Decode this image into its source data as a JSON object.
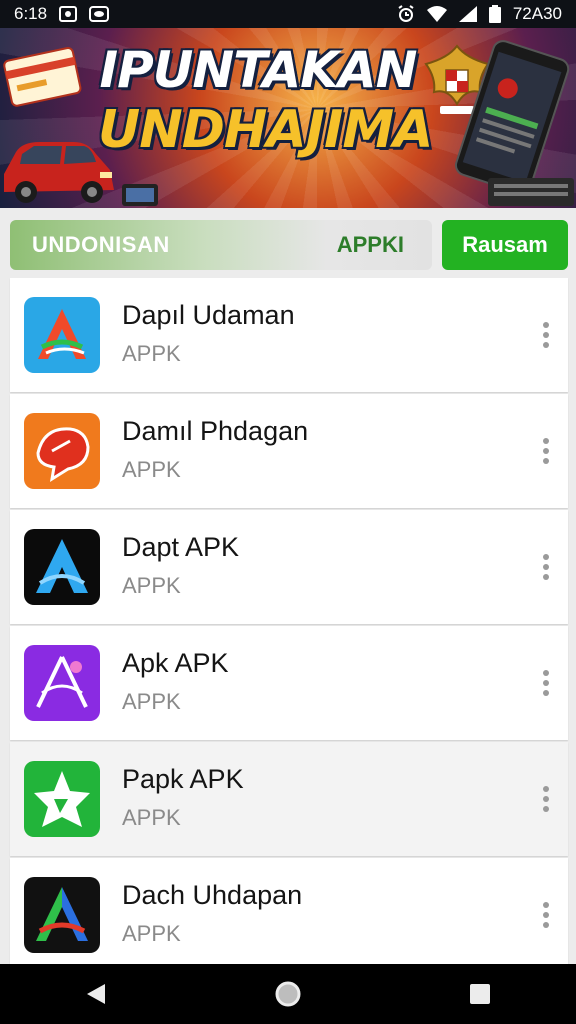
{
  "status_bar": {
    "time": "6:18",
    "right_text": "72A30",
    "icons": [
      "gallery-icon",
      "eye-icon",
      "alarm-icon",
      "wifi-icon",
      "signal-icon",
      "battery-icon"
    ]
  },
  "banner": {
    "title_line1": "IPUNTAKAN",
    "title_line2": "UNDHAJIMA"
  },
  "search": {
    "left_text": "UNDONISAN",
    "right_text": "APPKI",
    "button_label": "Rausam"
  },
  "apps": [
    {
      "name": "Dapıl Udaman",
      "subtitle": "APPK",
      "icon": "orange-blue-a-icon",
      "color": "#2aa7e6"
    },
    {
      "name": "Damıl Phdagan",
      "subtitle": "APPK",
      "icon": "red-bird-icon",
      "color": "#f07a1d"
    },
    {
      "name": "Dapt APK",
      "subtitle": "APPK",
      "icon": "blue-a-icon",
      "color": "#0b0b0b"
    },
    {
      "name": "Apk APK",
      "subtitle": "APPK",
      "icon": "purple-a-icon",
      "color": "#8a2be2"
    },
    {
      "name": "Papk APK",
      "subtitle": "APPK",
      "icon": "green-star-icon",
      "color": "#22b43a"
    },
    {
      "name": "Dach Uhdapan",
      "subtitle": "APPK",
      "icon": "rainbow-a-icon",
      "color": "#111111"
    }
  ],
  "nav": {
    "icons": [
      "back-icon",
      "home-icon",
      "recents-icon"
    ]
  },
  "colors": {
    "accent_green": "#23b222",
    "banner_yellow": "#f6c12a"
  }
}
